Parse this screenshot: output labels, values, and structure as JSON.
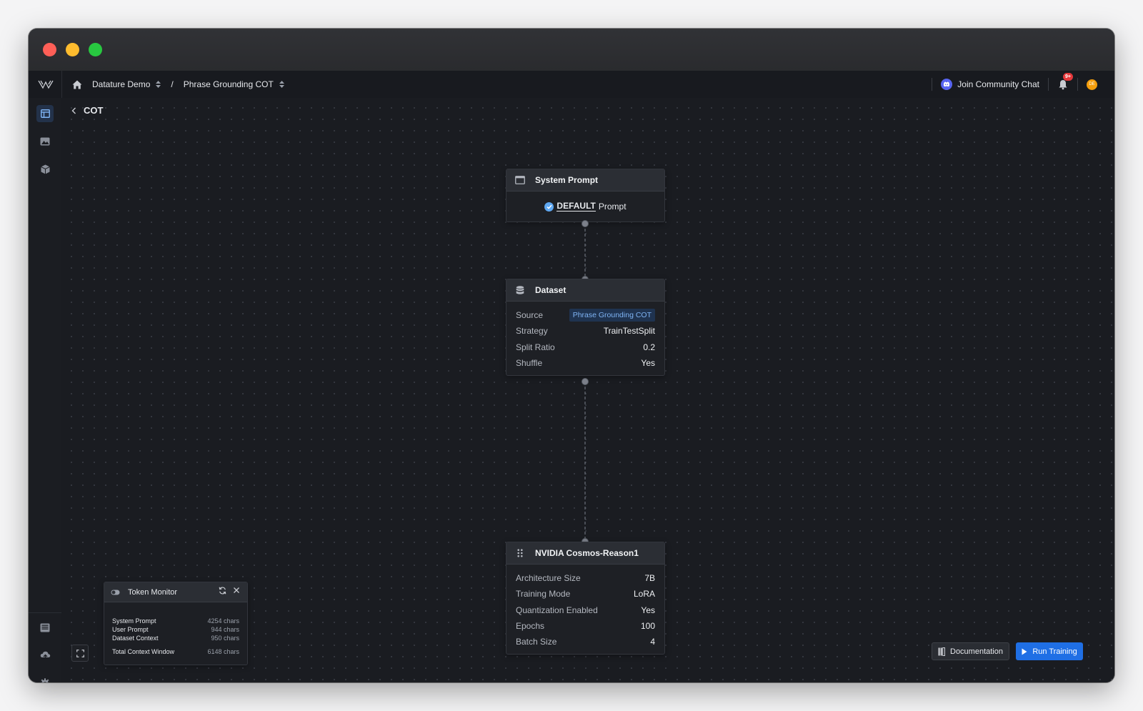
{
  "topbar": {
    "breadcrumb": [
      {
        "label": "Datature Demo"
      },
      {
        "label": "Phrase Grounding COT"
      }
    ],
    "separator": "/",
    "community_label": "Join Community Chat",
    "notification_count": "9+",
    "avatar_initials": "DE"
  },
  "canvas": {
    "back_title": "COT"
  },
  "nodes": {
    "system_prompt": {
      "title": "System Prompt",
      "default_label": "DEFAULT",
      "prompt_label": "Prompt"
    },
    "dataset": {
      "title": "Dataset",
      "rows": [
        {
          "key": "Source",
          "value": "Phrase Grounding COT"
        },
        {
          "key": "Strategy",
          "value": "TrainTestSplit"
        },
        {
          "key": "Split Ratio",
          "value": "0.2"
        },
        {
          "key": "Shuffle",
          "value": "Yes"
        }
      ]
    },
    "model": {
      "title": "NVIDIA Cosmos-Reason1",
      "rows": [
        {
          "key": "Architecture Size",
          "value": "7B"
        },
        {
          "key": "Training Mode",
          "value": "LoRA"
        },
        {
          "key": "Quantization Enabled",
          "value": "Yes"
        },
        {
          "key": "Epochs",
          "value": "100"
        },
        {
          "key": "Batch Size",
          "value": "4"
        }
      ]
    }
  },
  "token_monitor": {
    "title": "Token Monitor",
    "rows": [
      {
        "key": "System Prompt",
        "value": "4254 chars"
      },
      {
        "key": "User Prompt",
        "value": "944 chars"
      },
      {
        "key": "Dataset Context",
        "value": "950 chars"
      }
    ],
    "total": {
      "key": "Total Context Window",
      "value": "6148 chars"
    }
  },
  "actions": {
    "documentation_label": "Documentation",
    "run_label": "Run Training"
  },
  "colors": {
    "accent": "#1f6fe5",
    "canvas_bg": "#1a1c21",
    "tag_text": "#7fb4f4"
  }
}
